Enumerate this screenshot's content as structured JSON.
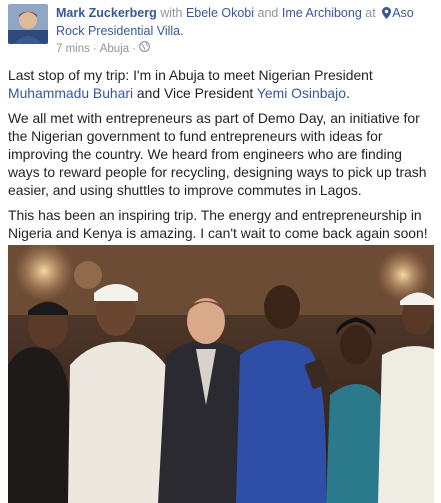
{
  "author": {
    "name": "Mark Zuckerberg",
    "with_word": "with",
    "tagged_1": "Ebele Okobi",
    "and_word": "and",
    "tagged_2": "Ime Archibong",
    "at_word": "at",
    "location": "Aso Rock Presidential Villa."
  },
  "meta": {
    "time": "7 mins",
    "separator": "·",
    "place": "Abuja",
    "separator2": "·"
  },
  "post": {
    "p1_a": "Last stop of my trip: I'm in Abuja to meet Nigerian President ",
    "p1_link1": "Muhammadu Buhari",
    "p1_b": " and Vice President ",
    "p1_link2": "Yemi Osinbajo",
    "p1_c": ".",
    "p2": "We all met with entrepreneurs as part of Demo Day, an initiative for the Nigerian government to fund entrepreneurs with ideas for improving the country. We heard from engineers who are finding ways to reward people for recycling, designing ways to pick up trash easier, and using shuttles to improve commutes in Lagos.",
    "p3": "This has been an inspiring trip. The energy and entrepreneurship in Nigeria and Kenya is amazing. I can't wait to come back again soon!"
  },
  "icons": {
    "location": "location-pin-icon",
    "privacy": "globe-icon"
  },
  "colors": {
    "link": "#365899",
    "meta": "#90949c",
    "text": "#1d2129"
  }
}
